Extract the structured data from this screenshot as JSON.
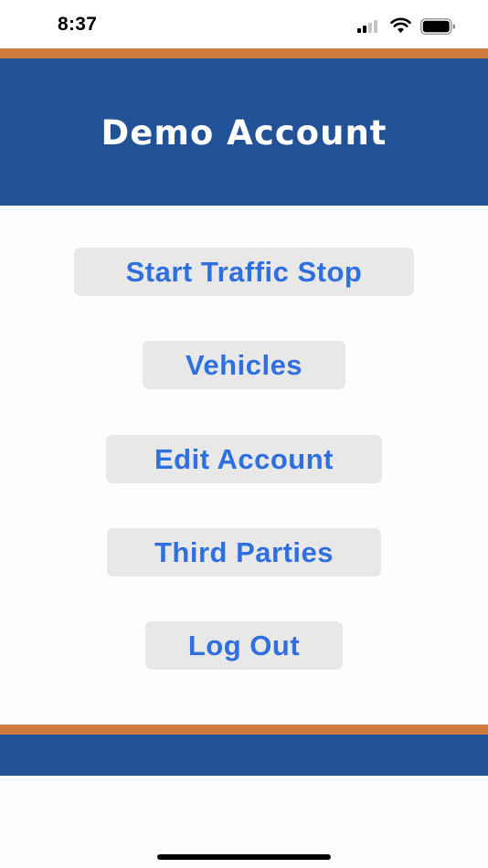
{
  "status_bar": {
    "time": "8:37",
    "icons": [
      "cellular-signal-icon",
      "wifi-icon",
      "battery-icon"
    ]
  },
  "header": {
    "title": "Demo Account"
  },
  "menu": {
    "start_traffic_stop": "Start Traffic Stop",
    "vehicles": "Vehicles",
    "edit_account": "Edit Account",
    "third_parties": "Third Parties",
    "log_out": "Log Out"
  },
  "colors": {
    "brand_blue": "#215196",
    "accent_orange": "#d07a3e",
    "button_text": "#2f6fe0",
    "button_bg": "#e8e8e8"
  }
}
